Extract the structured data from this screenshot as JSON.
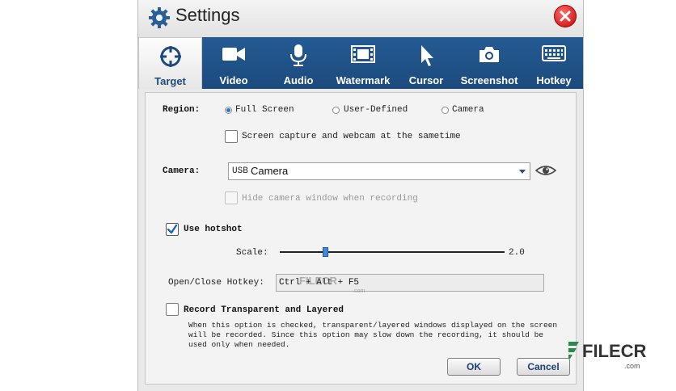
{
  "window": {
    "title": "Settings",
    "colors": {
      "tabbar": "#1c4a7d",
      "accent": "#2b74c7",
      "close": "#d51e1e"
    }
  },
  "tabs": [
    {
      "label": "Target",
      "icon": "target-icon",
      "active": true
    },
    {
      "label": "Video",
      "icon": "video-camera-icon",
      "active": false
    },
    {
      "label": "Audio",
      "icon": "microphone-icon",
      "active": false
    },
    {
      "label": "Watermark",
      "icon": "film-icon",
      "active": false
    },
    {
      "label": "Cursor",
      "icon": "cursor-icon",
      "active": false
    },
    {
      "label": "Screenshot",
      "icon": "camera-icon",
      "active": false
    },
    {
      "label": "Hotkey",
      "icon": "keyboard-icon",
      "active": false
    }
  ],
  "region": {
    "label": "Region:",
    "options": [
      {
        "label": "Full Screen",
        "selected": true
      },
      {
        "label": "User-Defined",
        "selected": false
      },
      {
        "label": "Camera",
        "selected": false
      }
    ],
    "webcam_checkbox": {
      "label": "Screen capture and webcam at the sametime",
      "checked": false
    }
  },
  "camera": {
    "label": "Camera:",
    "select_prefix": "USB",
    "select_value": "Camera",
    "hide_checkbox": {
      "label": "Hide camera window when recording",
      "checked": false,
      "disabled": true
    }
  },
  "hotshot": {
    "label": "Use hotshot",
    "checked": true,
    "scale_label": "Scale:",
    "scale_value": "2.0",
    "scale_position": 0.2,
    "hotkey_label": "Open/Close Hotkey:",
    "hotkey_value": "Ctrl + Alt + F5"
  },
  "transparent": {
    "label": "Record Transparent and Layered",
    "checked": false,
    "description": "When this option is checked, transparent/layered windows displayed on the screen will be recorded. Since this option may slow down the recording, it should be used only when needed."
  },
  "buttons": {
    "ok": "OK",
    "cancel": "Cancel"
  },
  "watermark": {
    "brand": "FILECR",
    "domain": ".com"
  }
}
